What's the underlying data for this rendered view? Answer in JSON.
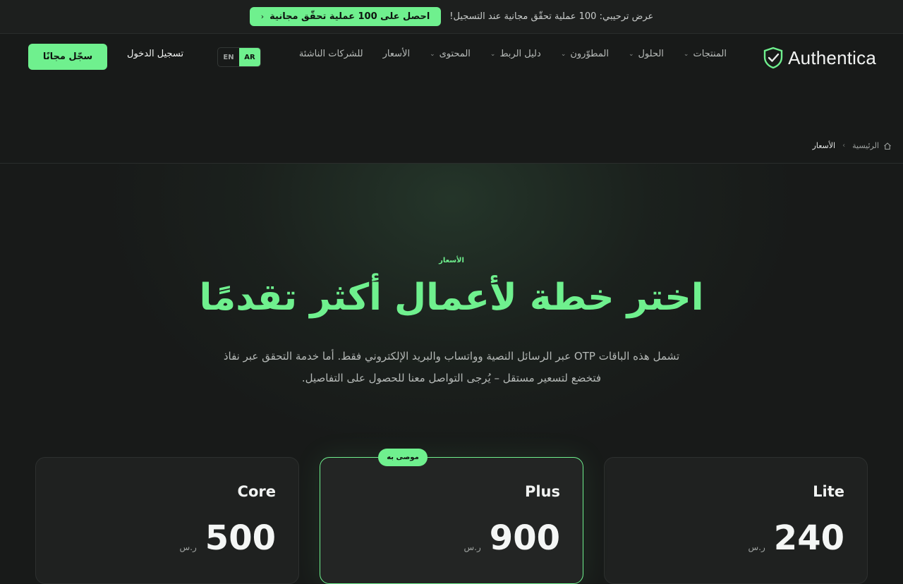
{
  "promo": {
    "text": "عرض ترحيبي: 100 عملية تحقّق مجانية عند التسجيل!",
    "cta_label": "احصل على 100 عملية تحقّق مجانية",
    "cta_chevron": "‹"
  },
  "header": {
    "logo_text": "Authentica",
    "nav": [
      {
        "label": "المنتجات",
        "has_dropdown": true
      },
      {
        "label": "الحلول",
        "has_dropdown": true
      },
      {
        "label": "المطوّرون",
        "has_dropdown": true
      },
      {
        "label": "دليل الربط",
        "has_dropdown": true
      },
      {
        "label": "المحتوى",
        "has_dropdown": true
      },
      {
        "label": "الأسعار",
        "has_dropdown": false
      },
      {
        "label": "للشركات الناشئة",
        "has_dropdown": false
      }
    ],
    "lang_en": "EN",
    "lang_ar": "AR",
    "login_label": "تسجيل الدخول",
    "signup_label": "سجّل مجانًا"
  },
  "breadcrumb": {
    "home": "الرئيسية",
    "current": "الأسعار",
    "separator": "›"
  },
  "hero": {
    "eyebrow": "الأسعار",
    "title": "اختر خطة لأعمال أكثر تقدمًا",
    "subtitle": "تشمل هذه الباقات OTP عبر الرسائل النصية وواتساب والبريد الإلكتروني فقط. أما خدمة التحقق عبر نفاذ فتخضع لتسعير مستقل – يُرجى التواصل معنا للحصول على التفاصيل."
  },
  "plans": [
    {
      "name": "Lite",
      "price": "240",
      "currency": "ر.س"
    },
    {
      "name": "Plus",
      "price": "900",
      "currency": "ر.س",
      "badge": "موصى به"
    },
    {
      "name": "Core",
      "price": "500",
      "currency": "ر.س"
    }
  ],
  "colors": {
    "accent": "#6ff08e",
    "background": "#181a19",
    "card": "#1f2120"
  }
}
